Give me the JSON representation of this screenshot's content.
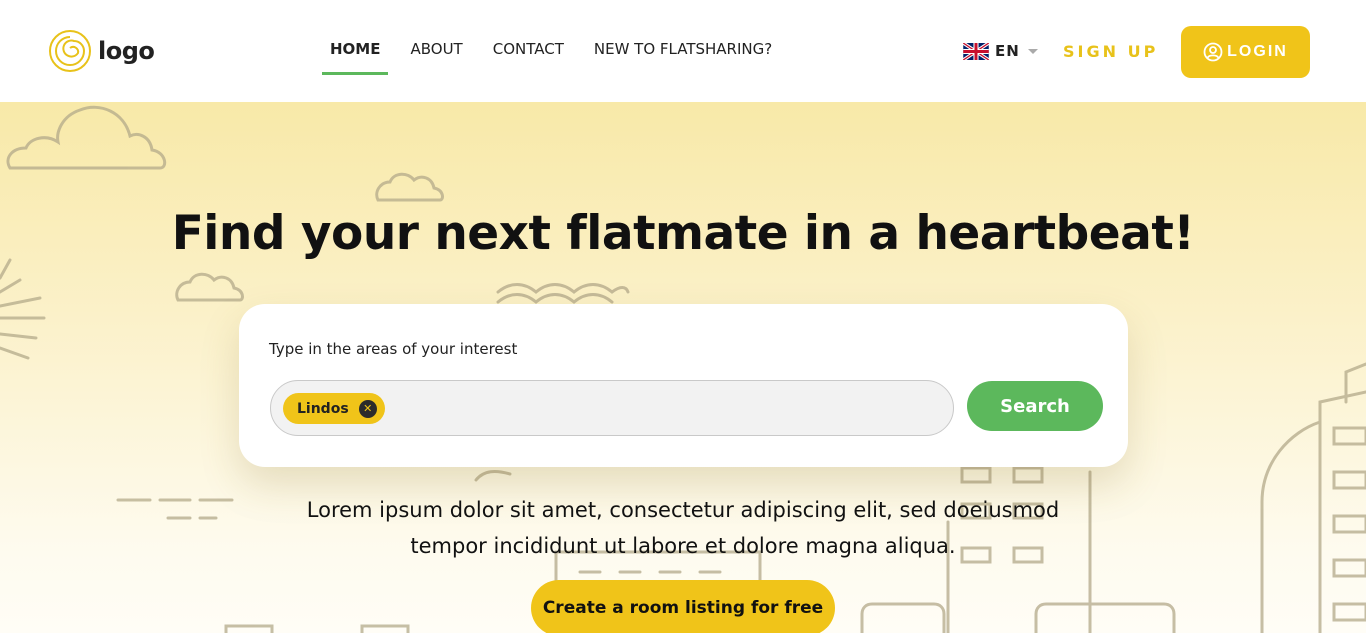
{
  "header": {
    "logo_text": "logo",
    "nav": {
      "home": "HOME",
      "about": "ABOUT",
      "contact": "CONTACT",
      "new_to_flatsharing": "NEW TO FLATSHARING?"
    },
    "language": "EN",
    "signup_label": "SIGN UP",
    "login_label": "LOGIN"
  },
  "hero": {
    "headline": "Find your next flatmate in a heartbeat!",
    "search": {
      "label": "Type in the areas of your interest",
      "tags": [
        "Lindos"
      ],
      "button_label": "Search"
    },
    "description": "Lorem ipsum dolor sit amet, consectetur adipiscing elit, sed doeiusmod tempor incididunt ut labore et dolore magna aliqua.",
    "cta_label": "Create a room listing for free"
  },
  "colors": {
    "accent_yellow": "#f0c419",
    "accent_green": "#5cb85c",
    "hero_background": "#f8e9a8"
  },
  "icons": [
    "logo-spiral-icon",
    "uk-flag-icon",
    "chevron-down-icon",
    "user-circle-icon",
    "close-icon"
  ]
}
